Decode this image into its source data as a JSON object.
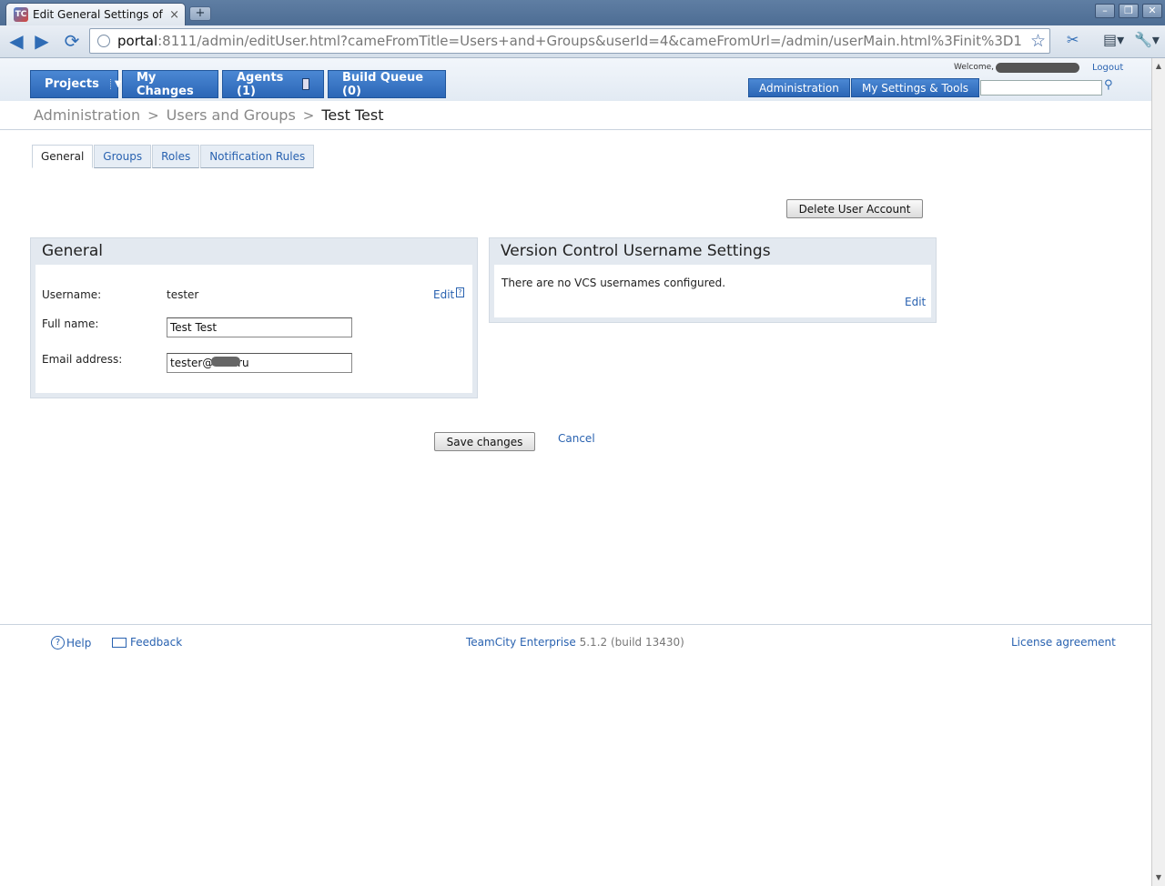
{
  "browser": {
    "tab_title": "Edit General Settings of ...",
    "tab_close": "×",
    "new_tab": "+",
    "url_host": "portal",
    "url_rest": ":8111/admin/editUser.html?cameFromTitle=Users+and+Groups&userId=4&cameFromUrl=/admin/userMain.html%3Finit%3D1",
    "favicon_text": "TC"
  },
  "nav": {
    "projects": "Projects",
    "my_changes": "My Changes",
    "agents": "Agents (1)",
    "build_queue": "Build Queue (0)",
    "welcome": "Welcome,",
    "logout": "Logout",
    "administration": "Administration",
    "my_settings": "My Settings & Tools"
  },
  "breadcrumb": {
    "items": [
      "Administration",
      "Users and Groups"
    ],
    "current": "Test Test"
  },
  "tabs": [
    "General",
    "Groups",
    "Roles",
    "Notification Rules"
  ],
  "actions": {
    "delete_user": "Delete User Account",
    "save": "Save changes",
    "cancel": "Cancel"
  },
  "general_panel": {
    "title": "General",
    "username_label": "Username:",
    "username_value": "tester",
    "edit": "Edit",
    "help_mark": "?",
    "fullname_label": "Full name:",
    "fullname_value": "Test Test",
    "email_label": "Email address:",
    "email_value": "tester@      .ru"
  },
  "vcs_panel": {
    "title": "Version Control Username Settings",
    "message": "There are no VCS usernames configured.",
    "edit": "Edit"
  },
  "footer": {
    "help": "Help",
    "feedback": "Feedback",
    "product": "TeamCity Enterprise",
    "version": "5.1.2 (build 13430)",
    "license": "License agreement"
  },
  "colors": {
    "link": "#2962b0",
    "nav_blue": "#2b66b6",
    "panel_bg": "#e3e9f0"
  }
}
